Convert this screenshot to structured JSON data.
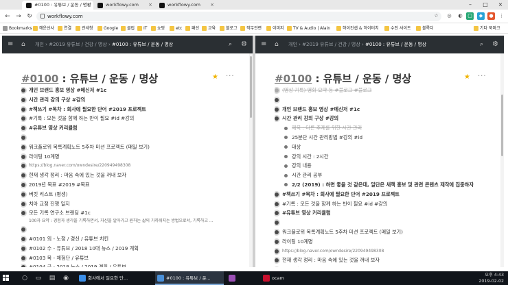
{
  "browser": {
    "tabs": [
      {
        "title": "#0100 : 유튜브 / 운동 / 명상",
        "active": true
      },
      {
        "title": "workflowy.com",
        "active": false
      },
      {
        "title": "workflowy.com",
        "active": false
      }
    ],
    "url": "workflowy.com",
    "bookmarks": [
      "Bookmarks",
      "해운선사",
      "연결",
      "관세청",
      "Google",
      "클럽",
      "IT",
      "쇼핑",
      "etc",
      "패션",
      "교육",
      "블로그",
      "직무관련",
      "이미지",
      "TV & Audio | Alain",
      "하이컨셉 & 하이터치",
      "수진 사이트",
      "블록더",
      "기타 북마크"
    ]
  },
  "left_pane": {
    "breadcrumb": [
      "개인",
      "#2019 유튜브 / 건강 / 명상",
      "#0100 : 유튜브 / 운동 / 명상"
    ],
    "title_tag": "#0100",
    "title_rest": " : 유튜브 / 운동 / 명상",
    "items": [
      {
        "text": "개인 브랜드 홍보 영상 #메신저 #1c",
        "kind": "b"
      },
      {
        "text": "시간 관리 강의 구상 #강의",
        "kind": "b"
      },
      {
        "text": "#책쓰기 #목차 : 회사에 필요한 단어 #2019 프로젝트",
        "kind": "b"
      },
      {
        "text": "#기록 : 모든 것을 함께 하는 반이 필요 #id #강의",
        "kind": ""
      },
      {
        "text": "#유튜브 영상 커리큘럼",
        "kind": "b"
      },
      {
        "text": "",
        "kind": ""
      },
      {
        "text": "워크플로위 목록계획노트 5주차 미션 프로젝트 (매일 보기)",
        "kind": ""
      },
      {
        "text": "라이팅 10계명",
        "kind": ""
      },
      {
        "text": "https://blog.naver.com/owndesire/220949498308",
        "kind": "url"
      },
      {
        "text": "현재 생각 정리 : 마음 속에 있는 것을 꺼내 보자",
        "kind": ""
      },
      {
        "text": "2019년 목표 #2019 #목표",
        "kind": ""
      },
      {
        "text": "버킷 리스트 (평생)",
        "kind": ""
      },
      {
        "text": "치아 교정 진행 일지",
        "kind": ""
      },
      {
        "text": "모든 기록 연구소 브랜딩 #1c",
        "kind": ""
      },
      {
        "text": "100자 요약 : 경험과 생각을 기록하면서, 자신을 알아가고 원하는 삶의 가까워지는 방법으로서, 기록하고 ...",
        "kind": "note"
      },
      {
        "text": "",
        "kind": ""
      },
      {
        "text": "#0101 외 - 노정 / 경신 / 유튜브 치킨",
        "kind": ""
      },
      {
        "text": "#0102 수 - 유튜브 / 2018 10대 뉴스 / 2019 계획",
        "kind": ""
      },
      {
        "text": "#0103 목 - 체험단 / 유튜브",
        "kind": ""
      },
      {
        "text": "#0104 금 - 2018 뉴스 / 2019 계획 / 유튜브",
        "kind": ""
      },
      {
        "text": "#0105 토 - 도서관 / 독서",
        "kind": ""
      }
    ]
  },
  "right_pane": {
    "breadcrumb": [
      "개인",
      "#2019 유튜브 / 건강 / 명상",
      "#0100 : 유튜브 / 운동 / 명상"
    ],
    "title_tag": "#0100",
    "title_rest": " : 유튜브 / 운동 / 명상",
    "items": [
      {
        "text": "(영상 기록) 영화 요약 등 #블로그 #블로그",
        "kind": "done"
      },
      {
        "text": "",
        "kind": ""
      },
      {
        "text": "개인 브랜드 홍보 영상 #메신저 #1c",
        "kind": "b"
      },
      {
        "text": "시간 관리 강의 구상 #강의",
        "kind": "b"
      },
      {
        "text": "제목 : 다른 주제를 위한 시간 관리",
        "kind": "sub done"
      },
      {
        "text": "25분단 시간 관리방법 #강의 #id",
        "kind": "sub"
      },
      {
        "text": "대상",
        "kind": "sub"
      },
      {
        "text": "강의 시간 : 2시간",
        "kind": "sub"
      },
      {
        "text": "강의 내용",
        "kind": "sub"
      },
      {
        "text": "시간 관리 공부",
        "kind": "sub"
      },
      {
        "text": "2/2 (2019) : 하면 좋을 것 같은데, 일단은 새책 홍보 및 관련 콘텐츠 제작에 집중하자",
        "kind": "sub b"
      },
      {
        "text": "#책쓰기 #목차 : 회사에 필요한 단어 #2019 프로젝트",
        "kind": "b"
      },
      {
        "text": "#기록 : 모든 것을 함께 하는 반이 필요 #id #강의",
        "kind": ""
      },
      {
        "text": "#유튜브 영상 커리큘럼",
        "kind": "b"
      },
      {
        "text": "",
        "kind": ""
      },
      {
        "text": "워크플로위 목록계획노트 5주차 미션 프로젝트 (매일 보기)",
        "kind": ""
      },
      {
        "text": "라이팅 10계명",
        "kind": ""
      },
      {
        "text": "https://blog.naver.com/owndesire/220949498308",
        "kind": "url"
      },
      {
        "text": "현재 생각 정리 : 마음 속에 있는 것을 꺼내 보자",
        "kind": ""
      },
      {
        "text": "2018년 목표 #2018",
        "kind": "done"
      },
      {
        "text": "2019년 목표 #2019 #목표",
        "kind": ""
      }
    ]
  },
  "taskbar": {
    "apps": [
      "회사에서 일요한 단...",
      "#0100 : 유튜브 / 운...",
      "",
      "ocam"
    ],
    "time": "오후 4:43",
    "date": "2019-02-02"
  },
  "colors": {
    "header_bg": "#2a2f33",
    "star": "#f0b400",
    "taskbar": "#10141a"
  }
}
